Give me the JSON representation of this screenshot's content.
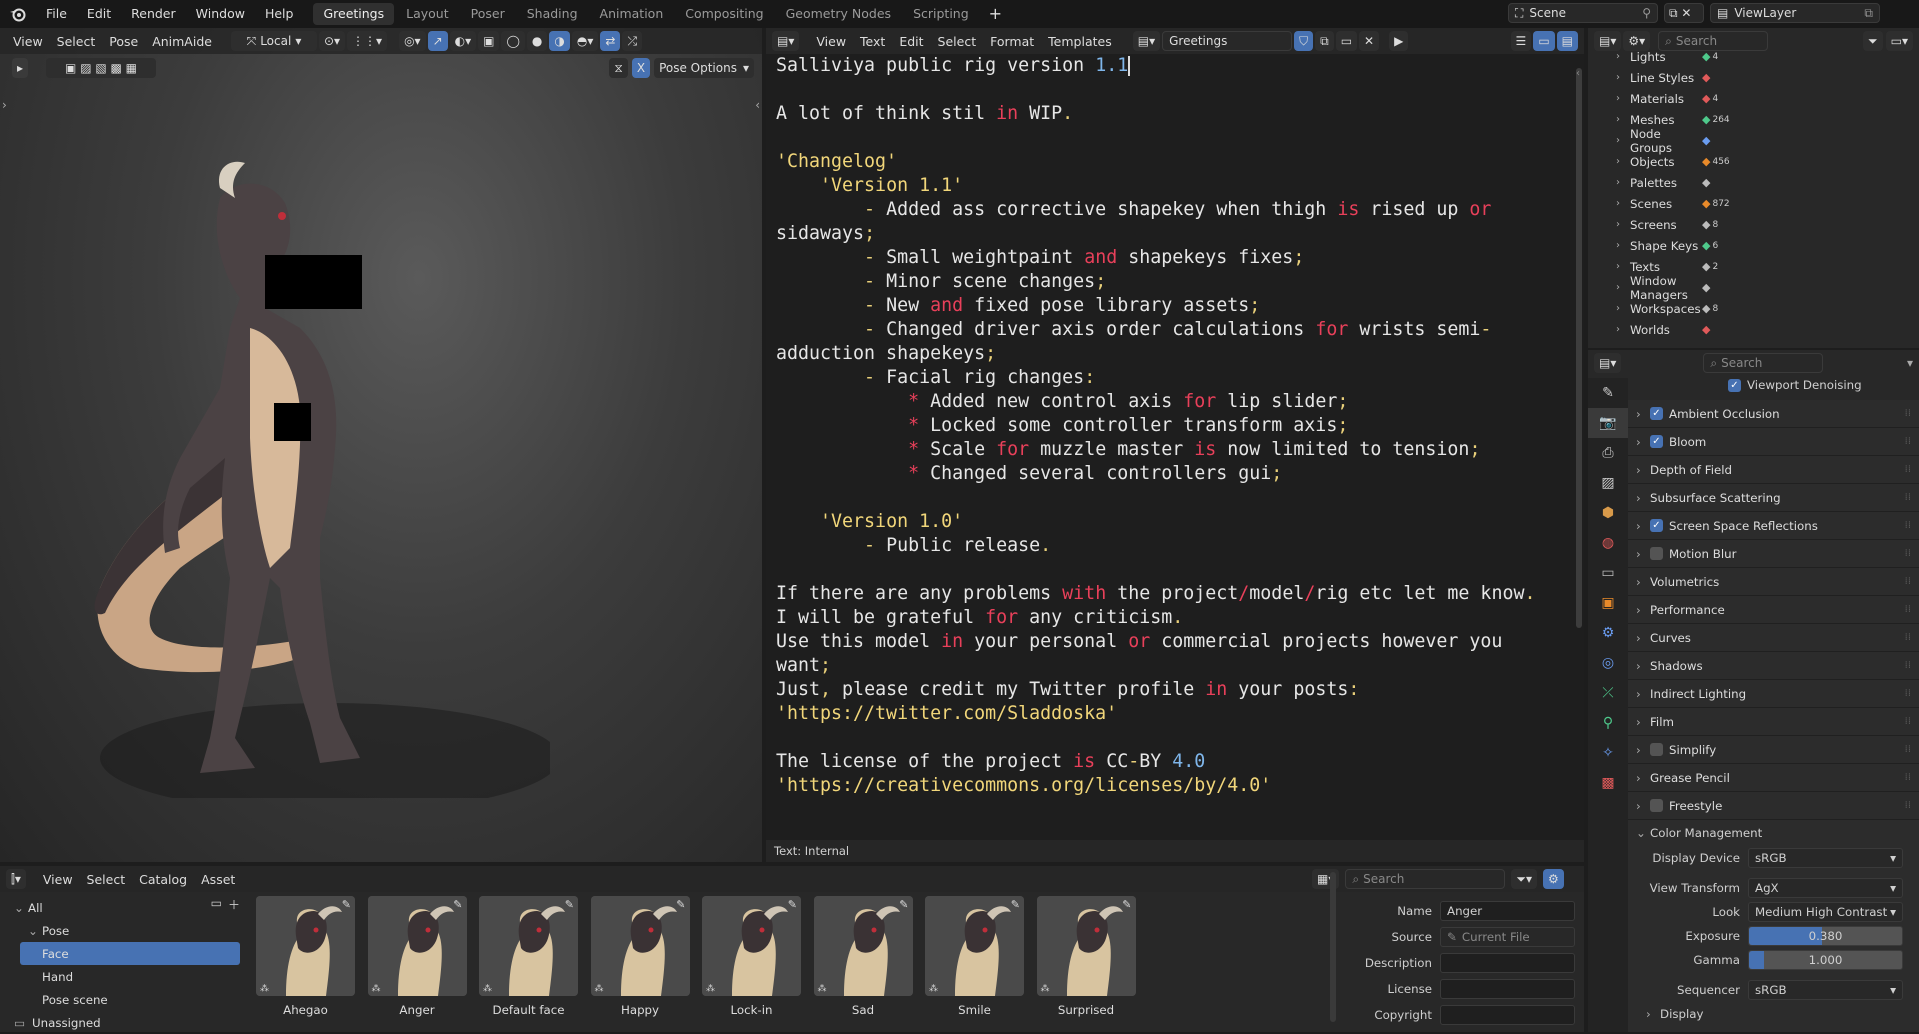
{
  "topbar": {
    "menus": [
      "File",
      "Edit",
      "Render",
      "Window",
      "Help"
    ],
    "workspaces": [
      "Greetings",
      "Layout",
      "Poser",
      "Shading",
      "Animation",
      "Compositing",
      "Geometry Nodes",
      "Scripting"
    ],
    "active_workspace": "Greetings",
    "add_tab": "+",
    "scene": "Scene",
    "view_layer": "ViewLayer"
  },
  "viewport": {
    "menus": [
      "View",
      "Select",
      "Pose",
      "AnimAide"
    ],
    "orientation": "Local",
    "pose_options": "Pose Options",
    "x_label": "X"
  },
  "text_editor": {
    "menus": [
      "View",
      "Text",
      "Edit",
      "Select",
      "Format",
      "Templates"
    ],
    "text_name": "Greetings",
    "footer": "Text: Internal",
    "lines": [
      [
        {
          "t": "Salliviya public rig version ",
          "c": ""
        },
        {
          "t": "1.1",
          "c": "nm"
        }
      ],
      [],
      [
        {
          "t": "A lot of think stil ",
          "c": ""
        },
        {
          "t": "in",
          "c": "kw"
        },
        {
          "t": " WIP",
          "c": ""
        },
        {
          "t": ".",
          "c": "pn"
        }
      ],
      [],
      [
        {
          "t": "'Changelog'",
          "c": "st"
        }
      ],
      [
        {
          "t": "    ",
          "c": ""
        },
        {
          "t": "'Version 1.1'",
          "c": "st"
        }
      ],
      [
        {
          "t": "        - ",
          "c": "pn"
        },
        {
          "t": "Added ass corrective shapekey when thigh ",
          "c": ""
        },
        {
          "t": "is",
          "c": "kw"
        },
        {
          "t": " rised up ",
          "c": ""
        },
        {
          "t": "or",
          "c": "kw"
        }
      ],
      [
        {
          "t": "sidaways",
          "c": ""
        },
        {
          "t": ";",
          "c": "pn"
        }
      ],
      [
        {
          "t": "        - ",
          "c": "pn"
        },
        {
          "t": "Small weightpaint ",
          "c": ""
        },
        {
          "t": "and",
          "c": "kw"
        },
        {
          "t": " shapekeys fixes",
          "c": ""
        },
        {
          "t": ";",
          "c": "pn"
        }
      ],
      [
        {
          "t": "        - ",
          "c": "pn"
        },
        {
          "t": "Minor scene changes",
          "c": ""
        },
        {
          "t": ";",
          "c": "pn"
        }
      ],
      [
        {
          "t": "        - ",
          "c": "pn"
        },
        {
          "t": "New ",
          "c": ""
        },
        {
          "t": "and",
          "c": "kw"
        },
        {
          "t": " fixed pose library assets",
          "c": ""
        },
        {
          "t": ";",
          "c": "pn"
        }
      ],
      [
        {
          "t": "        - ",
          "c": "pn"
        },
        {
          "t": "Changed driver axis order calculations ",
          "c": ""
        },
        {
          "t": "for",
          "c": "kw"
        },
        {
          "t": " wrists semi",
          "c": ""
        },
        {
          "t": "-",
          "c": "pn"
        }
      ],
      [
        {
          "t": "adduction shapekeys",
          "c": ""
        },
        {
          "t": ";",
          "c": "pn"
        }
      ],
      [
        {
          "t": "        - ",
          "c": "pn"
        },
        {
          "t": "Facial rig changes",
          "c": ""
        },
        {
          "t": ":",
          "c": "pn"
        }
      ],
      [
        {
          "t": "            * ",
          "c": "kw"
        },
        {
          "t": "Added new control axis ",
          "c": ""
        },
        {
          "t": "for",
          "c": "kw"
        },
        {
          "t": " lip slider",
          "c": ""
        },
        {
          "t": ";",
          "c": "pn"
        }
      ],
      [
        {
          "t": "            * ",
          "c": "kw"
        },
        {
          "t": "Locked some controller transform axis",
          "c": ""
        },
        {
          "t": ";",
          "c": "pn"
        }
      ],
      [
        {
          "t": "            * ",
          "c": "kw"
        },
        {
          "t": "Scale ",
          "c": ""
        },
        {
          "t": "for",
          "c": "kw"
        },
        {
          "t": " muzzle master ",
          "c": ""
        },
        {
          "t": "is",
          "c": "kw"
        },
        {
          "t": " now limited to tension",
          "c": ""
        },
        {
          "t": ";",
          "c": "pn"
        }
      ],
      [
        {
          "t": "            * ",
          "c": "kw"
        },
        {
          "t": "Changed several controllers gui",
          "c": ""
        },
        {
          "t": ";",
          "c": "pn"
        }
      ],
      [],
      [
        {
          "t": "    ",
          "c": ""
        },
        {
          "t": "'Version 1.0'",
          "c": "st"
        }
      ],
      [
        {
          "t": "        - ",
          "c": "pn"
        },
        {
          "t": "Public release",
          "c": ""
        },
        {
          "t": ".",
          "c": "pn"
        }
      ],
      [],
      [
        {
          "t": "If there are any problems ",
          "c": ""
        },
        {
          "t": "with",
          "c": "kw"
        },
        {
          "t": " the project",
          "c": ""
        },
        {
          "t": "/",
          "c": "kw"
        },
        {
          "t": "model",
          "c": ""
        },
        {
          "t": "/",
          "c": "kw"
        },
        {
          "t": "rig etc let me know",
          "c": ""
        },
        {
          "t": ".",
          "c": "pn"
        }
      ],
      [
        {
          "t": "I will be grateful ",
          "c": ""
        },
        {
          "t": "for",
          "c": "kw"
        },
        {
          "t": " any criticism",
          "c": ""
        },
        {
          "t": ".",
          "c": "pn"
        }
      ],
      [
        {
          "t": "Use this model ",
          "c": ""
        },
        {
          "t": "in",
          "c": "kw"
        },
        {
          "t": " your personal ",
          "c": ""
        },
        {
          "t": "or",
          "c": "kw"
        },
        {
          "t": " commercial projects however you",
          "c": ""
        }
      ],
      [
        {
          "t": "want",
          "c": ""
        },
        {
          "t": ";",
          "c": "pn"
        }
      ],
      [
        {
          "t": "Just",
          "c": ""
        },
        {
          "t": ",",
          "c": "pn"
        },
        {
          "t": " please credit my Twitter profile ",
          "c": ""
        },
        {
          "t": "in",
          "c": "kw"
        },
        {
          "t": " your posts",
          "c": ""
        },
        {
          "t": ":",
          "c": "pn"
        }
      ],
      [
        {
          "t": "'https://twitter.com/Sladdoska'",
          "c": "st"
        }
      ],
      [],
      [
        {
          "t": "The license of the project ",
          "c": ""
        },
        {
          "t": "is",
          "c": "kw"
        },
        {
          "t": " CC",
          "c": ""
        },
        {
          "t": "-",
          "c": "pn"
        },
        {
          "t": "BY ",
          "c": ""
        },
        {
          "t": "4.0",
          "c": "nm"
        }
      ],
      [
        {
          "t": "'https://creativecommons.org/licenses/by/4.0'",
          "c": "st"
        }
      ]
    ]
  },
  "outliner": {
    "search_placeholder": "Search",
    "rows": [
      {
        "label": "Lights",
        "count": "4"
      },
      {
        "label": "Line Styles",
        "count": ""
      },
      {
        "label": "Materials",
        "count": "4"
      },
      {
        "label": "Meshes",
        "count": "264"
      },
      {
        "label": "Node Groups",
        "count": ""
      },
      {
        "label": "Objects",
        "count": "456"
      },
      {
        "label": "Palettes",
        "count": ""
      },
      {
        "label": "Scenes",
        "count": "872"
      },
      {
        "label": "Screens",
        "count": "8"
      },
      {
        "label": "Shape Keys",
        "count": "6"
      },
      {
        "label": "Texts",
        "count": "2"
      },
      {
        "label": "Window Managers",
        "count": ""
      },
      {
        "label": "Workspaces",
        "count": "8"
      },
      {
        "label": "Worlds",
        "count": ""
      }
    ]
  },
  "properties": {
    "search_placeholder": "Search",
    "viewport_denoising": "Viewport Denoising",
    "panels": [
      {
        "label": "Ambient Occlusion",
        "check": "on"
      },
      {
        "label": "Bloom",
        "check": "on"
      },
      {
        "label": "Depth of Field",
        "check": "none"
      },
      {
        "label": "Subsurface Scattering",
        "check": "none"
      },
      {
        "label": "Screen Space Reflections",
        "check": "on"
      },
      {
        "label": "Motion Blur",
        "check": "off"
      },
      {
        "label": "Volumetrics",
        "check": "none"
      },
      {
        "label": "Performance",
        "check": "none"
      },
      {
        "label": "Curves",
        "check": "none"
      },
      {
        "label": "Shadows",
        "check": "none"
      },
      {
        "label": "Indirect Lighting",
        "check": "none"
      },
      {
        "label": "Film",
        "check": "none"
      },
      {
        "label": "Simplify",
        "check": "off"
      },
      {
        "label": "Grease Pencil",
        "check": "none"
      },
      {
        "label": "Freestyle",
        "check": "off"
      }
    ],
    "color_management": {
      "title": "Color Management",
      "display_device_label": "Display Device",
      "display_device": "sRGB",
      "view_transform_label": "View Transform",
      "view_transform": "AgX",
      "look_label": "Look",
      "look": "Medium High Contrast",
      "exposure_label": "Exposure",
      "exposure": "0.380",
      "exposure_fill": 0.48,
      "gamma_label": "Gamma",
      "gamma": "1.000",
      "gamma_fill": 0.1,
      "sequencer_label": "Sequencer",
      "sequencer": "sRGB",
      "display_sub": "Display"
    }
  },
  "assets": {
    "menus": [
      "View",
      "Select",
      "Catalog",
      "Asset"
    ],
    "search_placeholder": "Search",
    "tree": [
      {
        "label": "All",
        "indent": 0,
        "arrow": "v",
        "selected": false
      },
      {
        "label": "Pose",
        "indent": 1,
        "arrow": "v",
        "selected": false
      },
      {
        "label": "Face",
        "indent": 2,
        "arrow": "",
        "selected": true
      },
      {
        "label": "Hand",
        "indent": 2,
        "arrow": "",
        "selected": false
      },
      {
        "label": "Pose scene",
        "indent": 2,
        "arrow": "",
        "selected": false
      },
      {
        "label": "Unassigned",
        "indent": 0,
        "arrow": "",
        "selected": false
      }
    ],
    "items": [
      "Ahegao",
      "Anger",
      "Default face",
      "Happy",
      "Lock-in",
      "Sad",
      "Smile",
      "Surprised"
    ],
    "details": {
      "name_label": "Name",
      "name": "Anger",
      "source_label": "Source",
      "source": "Current File",
      "description_label": "Description",
      "description": "",
      "license_label": "License",
      "license": "",
      "copyright_label": "Copyright",
      "copyright": ""
    }
  },
  "colors": {
    "accent": "#4772b3",
    "keyword": "#e8405a",
    "string": "#f1d67a",
    "number": "#7fb6ea"
  }
}
